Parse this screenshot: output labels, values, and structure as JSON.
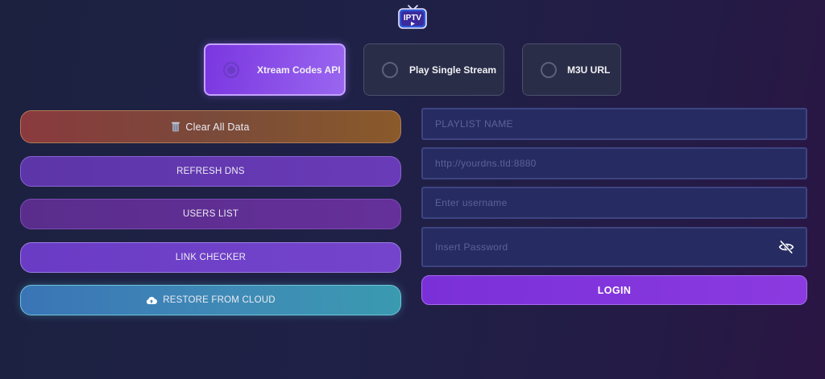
{
  "app": {
    "logo_text": "IPTV",
    "logo_icon": "tv-play-icon"
  },
  "modes": [
    {
      "label": "Xtream Codes API",
      "selected": true
    },
    {
      "label": "Play Single Stream",
      "selected": false
    },
    {
      "label": "M3U URL",
      "selected": false
    }
  ],
  "actions": {
    "clear_all": {
      "label": "Clear All Data",
      "icon": "trash-icon"
    },
    "refresh_dns": {
      "label": "REFRESH DNS"
    },
    "users_list": {
      "label": "USERS LIST"
    },
    "link_checker": {
      "label": "LINK CHECKER"
    },
    "restore": {
      "label": "RESTORE FROM CLOUD",
      "icon": "cloud-upload-icon"
    }
  },
  "form": {
    "playlist_name": {
      "value": "",
      "placeholder": "PLAYLIST NAME"
    },
    "dns_url": {
      "value": "",
      "placeholder": "http://yourdns.tld:8880"
    },
    "username": {
      "value": "",
      "placeholder": "Enter username"
    },
    "password": {
      "value": "",
      "placeholder": "Insert Password",
      "toggle_icon": "eye-off-icon"
    },
    "login_label": "LOGIN"
  },
  "colors": {
    "accent": "#8b3ae0",
    "selected_mode": "#9a66f0",
    "restore": "#3f8ab6"
  }
}
